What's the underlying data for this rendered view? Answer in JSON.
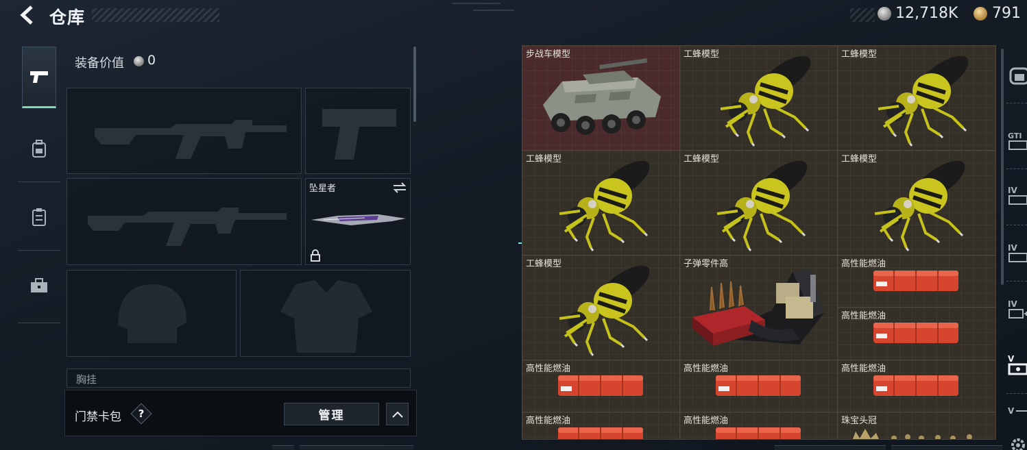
{
  "header": {
    "title": "仓库",
    "currency_silver": "12,718K",
    "currency_gold": "791"
  },
  "sidebar": {
    "items": [
      {
        "icon": "pistol-icon",
        "active": true
      },
      {
        "icon": "backpack-icon",
        "active": false
      },
      {
        "icon": "vest-icon",
        "active": false
      },
      {
        "icon": "toolbox-icon",
        "active": false
      }
    ]
  },
  "equipment": {
    "value_label": "装备价值",
    "value": "0",
    "slots": {
      "primary1": {
        "label": ""
      },
      "pistol": {
        "label": ""
      },
      "primary2": {
        "label": ""
      },
      "melee": {
        "label": "坠星者"
      },
      "helmet": {
        "label": ""
      },
      "armor": {
        "label": ""
      },
      "chest_rig": {
        "label": "胸挂"
      }
    }
  },
  "access_card": {
    "label": "门禁卡包",
    "help": "?",
    "manage_button": "管理"
  },
  "stash": {
    "items": [
      {
        "name": "步战车模型",
        "icon": "ifv-model"
      },
      {
        "name": "工蜂模型",
        "icon": "worker-bee-model"
      },
      {
        "name": "工蜂模型",
        "icon": "worker-bee-model"
      },
      {
        "name": "工蜂模型",
        "icon": "worker-bee-model"
      },
      {
        "name": "工蜂模型",
        "icon": "worker-bee-model"
      },
      {
        "name": "工蜂模型",
        "icon": "worker-bee-model"
      },
      {
        "name": "工蜂模型",
        "icon": "worker-bee-model"
      },
      {
        "name": "子弹零件高",
        "icon": "ammo-parts-crate"
      },
      {
        "name": "高性能燃油",
        "icon": "fuel-canister"
      },
      {
        "name": "高性能燃油",
        "icon": "fuel-canister"
      },
      {
        "name": "高性能燃油",
        "icon": "fuel-canister"
      },
      {
        "name": "高性能燃油",
        "icon": "fuel-canister"
      },
      {
        "name": "高性能燃油",
        "icon": "fuel-canister"
      },
      {
        "name": "高性能燃油",
        "icon": "fuel-canister"
      },
      {
        "name": "高性能燃油",
        "icon": "fuel-canister"
      },
      {
        "name": "珠宝头冠",
        "icon": "jeweled-crown"
      }
    ]
  },
  "right_sidebar": {
    "tabs": [
      {
        "icon": "vehicle-tab-icon"
      },
      {
        "icon": "gti-tab-icon"
      },
      {
        "icon": "iv-tab-icon"
      },
      {
        "icon": "iv-tab-icon"
      },
      {
        "icon": "iv-add-tab-icon"
      },
      {
        "icon": "v-tab-icon"
      },
      {
        "icon": "v-tab-icon"
      },
      {
        "icon": "settings-gear-icon"
      }
    ]
  }
}
